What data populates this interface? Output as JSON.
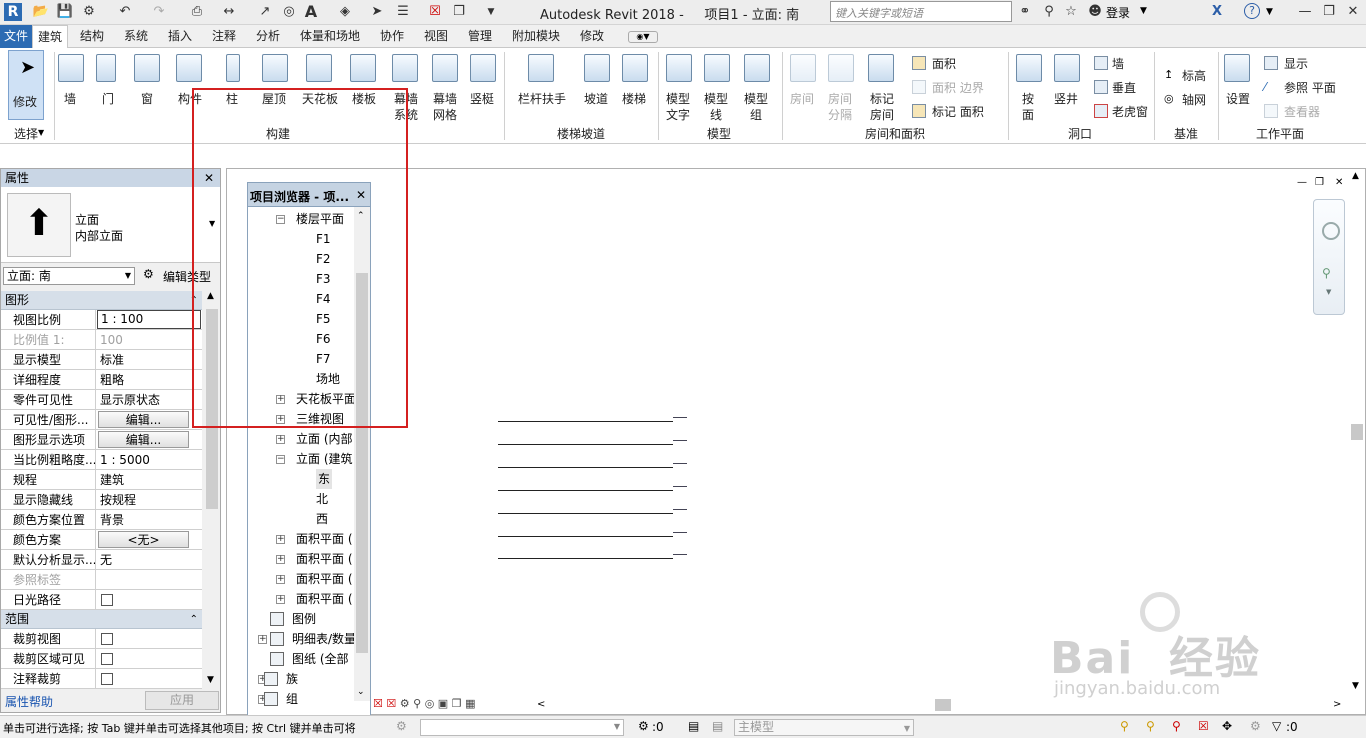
{
  "app": {
    "title": "Autodesk Revit 2018 -     项目1 - 立面: 南"
  },
  "search": {
    "placeholder": "键入关键字或短语"
  },
  "account": {
    "login": "登录"
  },
  "tabs": [
    "文件",
    "建筑",
    "结构",
    "系统",
    "插入",
    "注释",
    "分析",
    "体量和场地",
    "协作",
    "视图",
    "管理",
    "附加模块",
    "修改"
  ],
  "ribbon": {
    "select": {
      "modify": "修改",
      "group": "选择"
    },
    "build": {
      "wall": "墙",
      "door": "门",
      "window": "窗",
      "component": "构件",
      "column": "柱",
      "roof": "屋顶",
      "ceiling": "天花板",
      "floor": "楼板",
      "curtain_system_1": "幕墙",
      "curtain_system_2": "系统",
      "curtain_grid_1": "幕墙",
      "curtain_grid_2": "网格",
      "mullion": "竖梃",
      "group": "构建"
    },
    "stairs": {
      "railing": "栏杆扶手",
      "ramp": "坡道",
      "stair": "楼梯",
      "group": "楼梯坡道"
    },
    "model": {
      "text_1": "模型",
      "text_2": "文字",
      "line_1": "模型",
      "line_2": "线",
      "mgroup_1": "模型",
      "mgroup_2": "组",
      "group": "模型"
    },
    "room": {
      "room": "房间",
      "sep_1": "房间",
      "sep_2": "分隔",
      "tag_1": "标记",
      "tag_2": "房间",
      "area": "面积",
      "area_boundary": "面积 边界",
      "tag_area": "标记 面积",
      "group": "房间和面积"
    },
    "opening": {
      "by_face_1": "按",
      "by_face_2": "面",
      "shaft": "竖井",
      "wall": "墙",
      "vertical": "垂直",
      "dormer": "老虎窗",
      "group": "洞口"
    },
    "datum": {
      "level": "标高",
      "grid": "轴网",
      "group": "基准"
    },
    "workplane": {
      "set": "设置",
      "show": "显示",
      "ref_plane": "参照 平面",
      "viewer": "查看器",
      "group": "工作平面"
    }
  },
  "properties": {
    "title": "属性",
    "type_line1": "立面",
    "type_line2": "内部立面",
    "view_selector": "立面: 南",
    "edit_type": "编辑类型",
    "section_graphics": "图形",
    "rows": [
      {
        "k": "视图比例",
        "v": "1 : 100"
      },
      {
        "k": "比例值 1:",
        "v": "100"
      },
      {
        "k": "显示模型",
        "v": "标准"
      },
      {
        "k": "详细程度",
        "v": "粗略"
      },
      {
        "k": "零件可见性",
        "v": "显示原状态"
      },
      {
        "k": "可见性/图形...",
        "v": "编辑..."
      },
      {
        "k": "图形显示选项",
        "v": "编辑..."
      },
      {
        "k": "当比例粗略度...",
        "v": "1 : 5000"
      },
      {
        "k": "规程",
        "v": "建筑"
      },
      {
        "k": "显示隐藏线",
        "v": "按规程"
      },
      {
        "k": "颜色方案位置",
        "v": "背景"
      },
      {
        "k": "颜色方案",
        "v": "<无>"
      },
      {
        "k": "默认分析显示...",
        "v": "无"
      },
      {
        "k": "参照标签",
        "v": ""
      },
      {
        "k": "日光路径",
        "v": ""
      }
    ],
    "section_extent": "范围",
    "rows2": [
      {
        "k": "裁剪视图",
        "v": ""
      },
      {
        "k": "裁剪区域可见",
        "v": ""
      },
      {
        "k": "注释裁剪",
        "v": ""
      }
    ],
    "help": "属性帮助",
    "apply": "应用"
  },
  "browser": {
    "title": "项目浏览器 - 项...",
    "nodes": [
      "楼层平面",
      "F1",
      "F2",
      "F3",
      "F4",
      "F5",
      "F6",
      "F7",
      "场地",
      "天花板平面",
      "三维视图",
      "立面 (内部",
      "立面 (建筑",
      "东",
      "北",
      "西",
      "面积平面 (",
      "面积平面 (",
      "面积平面 (",
      "面积平面 (",
      "图例",
      "明细表/数量",
      "图纸 (全部",
      "族",
      "组"
    ]
  },
  "status": {
    "text": "单击可进行选择; 按 Tab 键并单击可选择其他项目; 按 Ctrl 键并单击可将",
    "count": ":0",
    "model": "主模型",
    "filter_count": ":0"
  },
  "watermark": {
    "line1": "Bai  经验",
    "line2": "jingyan.baidu.com"
  },
  "colors": {
    "accent": "#2c6bb3",
    "highlight_box": "#d42020"
  }
}
